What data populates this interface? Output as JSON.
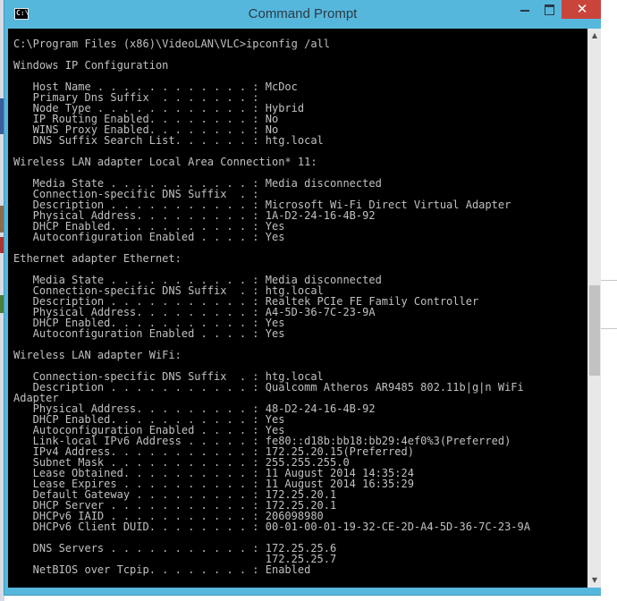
{
  "window": {
    "title": "Command Prompt",
    "icon_text": "C:\\",
    "close_glyph": "✕"
  },
  "console": {
    "lines": [
      "C:\\Program Files (x86)\\VideoLAN\\VLC>ipconfig /all",
      "",
      "Windows IP Configuration",
      "",
      "   Host Name . . . . . . . . . . . . : McDoc",
      "   Primary Dns Suffix  . . . . . . . :",
      "   Node Type . . . . . . . . . . . . : Hybrid",
      "   IP Routing Enabled. . . . . . . . : No",
      "   WINS Proxy Enabled. . . . . . . . : No",
      "   DNS Suffix Search List. . . . . . : htg.local",
      "",
      "Wireless LAN adapter Local Area Connection* 11:",
      "",
      "   Media State . . . . . . . . . . . : Media disconnected",
      "   Connection-specific DNS Suffix  . :",
      "   Description . . . . . . . . . . . : Microsoft Wi-Fi Direct Virtual Adapter",
      "   Physical Address. . . . . . . . . : 1A-D2-24-16-4B-92",
      "   DHCP Enabled. . . . . . . . . . . : Yes",
      "   Autoconfiguration Enabled . . . . : Yes",
      "",
      "Ethernet adapter Ethernet:",
      "",
      "   Media State . . . . . . . . . . . : Media disconnected",
      "   Connection-specific DNS Suffix  . : htg.local",
      "   Description . . . . . . . . . . . : Realtek PCIe FE Family Controller",
      "   Physical Address. . . . . . . . . : A4-5D-36-7C-23-9A",
      "   DHCP Enabled. . . . . . . . . . . : Yes",
      "   Autoconfiguration Enabled . . . . : Yes",
      "",
      "Wireless LAN adapter WiFi:",
      "",
      "   Connection-specific DNS Suffix  . : htg.local",
      "   Description . . . . . . . . . . . : Qualcomm Atheros AR9485 802.11b|g|n WiFi",
      "Adapter",
      "   Physical Address. . . . . . . . . : 48-D2-24-16-4B-92",
      "   DHCP Enabled. . . . . . . . . . . : Yes",
      "   Autoconfiguration Enabled . . . . : Yes",
      "   Link-local IPv6 Address . . . . . : fe80::d18b:bb18:bb29:4ef0%3(Preferred)",
      "   IPv4 Address. . . . . . . . . . . : 172.25.20.15(Preferred)",
      "   Subnet Mask . . . . . . . . . . . : 255.255.255.0",
      "   Lease Obtained. . . . . . . . . . : 11 August 2014 14:35:24",
      "   Lease Expires . . . . . . . . . . : 11 August 2014 16:35:29",
      "   Default Gateway . . . . . . . . . : 172.25.20.1",
      "   DHCP Server . . . . . . . . . . . : 172.25.20.1",
      "   DHCPv6 IAID . . . . . . . . . . . : 206098980",
      "   DHCPv6 Client DUID. . . . . . . . : 00-01-00-01-19-32-CE-2D-A4-5D-36-7C-23-9A",
      "",
      "   DNS Servers . . . . . . . . . . . : 172.25.25.6",
      "                                       172.25.25.7",
      "   NetBIOS over Tcpip. . . . . . . . : Enabled"
    ]
  },
  "scrollbar": {
    "up_glyph": "▲",
    "down_glyph": "▼",
    "thumb_position_fraction": 0.55
  },
  "colors": {
    "titlebar": "#56b7dd",
    "close_button": "#c9443a",
    "console_background": "#000000",
    "console_text": "#c0c0c0"
  }
}
